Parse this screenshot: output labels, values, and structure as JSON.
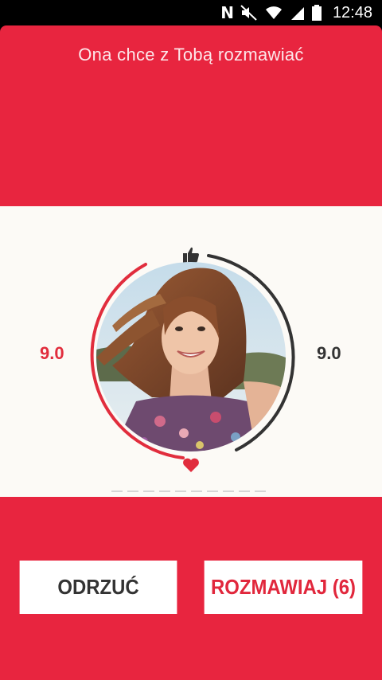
{
  "status_bar": {
    "time": "12:48"
  },
  "header": {
    "title": "Ona chce z Tobą rozmawiać"
  },
  "profile": {
    "score_left": "9.0",
    "score_right": "9.0"
  },
  "actions": {
    "reject_label": "ODRZUĆ",
    "chat_label": "ROZMAWIAJ (6)"
  },
  "colors": {
    "accent": "#e8253f",
    "band": "#fcfaf6",
    "ring_dark": "#333333",
    "ring_red": "#e12d3d"
  }
}
